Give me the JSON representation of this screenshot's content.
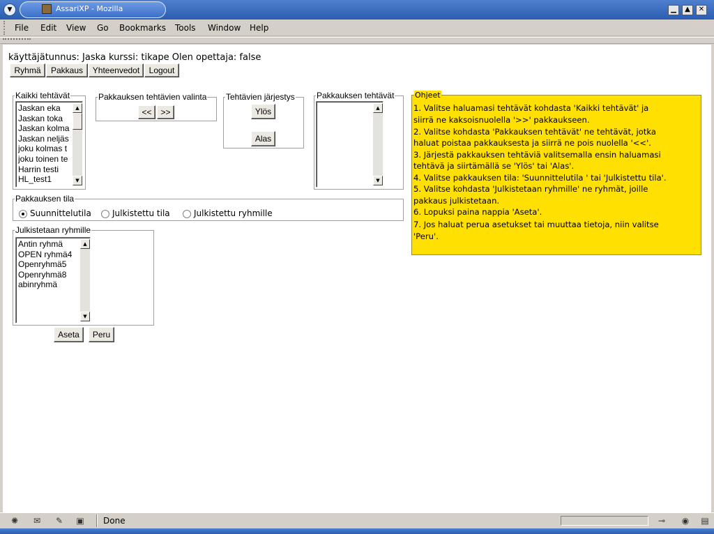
{
  "window": {
    "title": "AssariXP - Mozilla"
  },
  "menu": [
    "File",
    "Edit",
    "View",
    "Go",
    "Bookmarks",
    "Tools",
    "Window",
    "Help"
  ],
  "info_line": "käyttäjätunnus: Jaska kurssi: tikape Olen opettaja: false",
  "nav_buttons": [
    "Ryhmä",
    "Pakkaus",
    "Yhteenvedot",
    "Logout"
  ],
  "all_tasks": {
    "legend": "Kaikki tehtävät",
    "items": [
      "Jaskan eka",
      "Jaskan toka",
      "Jaskan kolma",
      "Jaskan neljäs",
      "joku kolmas t",
      "joku toinen te",
      "Harrin testi",
      "HL_test1"
    ]
  },
  "package_selection": {
    "legend": "Pakkauksen tehtävien valinta",
    "left": "<<",
    "right": ">>"
  },
  "task_order": {
    "legend": "Tehtävien järjestys",
    "up": "Ylös",
    "down": "Alas"
  },
  "package_tasks": {
    "legend": "Pakkauksen tehtävät"
  },
  "package_state": {
    "legend": "Pakkauksen tila",
    "options": [
      "Suunnittelutila",
      "Julkistettu tila",
      "Julkistettu ryhmille"
    ],
    "selected": 0
  },
  "publish_groups": {
    "legend": "Julkistetaan ryhmille",
    "items": [
      "Antin ryhmä",
      "OPEN ryhmä4",
      "Openryhmä5",
      "Openryhmä8",
      "abinryhmä"
    ]
  },
  "actions": {
    "set": "Aseta",
    "cancel": "Peru"
  },
  "help": {
    "legend": "Ohjeet",
    "lines": [
      "1. Valitse haluamasi tehtävät kohdasta 'Kaikki tehtävät' ja",
      "siirrä ne kaksoisnuolella '>>' pakkaukseen.",
      "2. Valitse kohdasta 'Pakkauksen tehtävät' ne tehtävät, jotka",
      "haluat poistaa pakkauksesta ja siirrä ne pois nuolella '<<'.",
      "3. Järjestä pakkauksen tehtäviä valitsemalla ensin haluamasi",
      "tehtävä ja siirtämällä se 'Ylös' tai 'Alas'.",
      "4. Valitse pakkauksen tila: 'Suunnittelutila ' tai 'Julkistettu tila'.",
      "5. Valitse kohdasta 'Julkistetaan ryhmille' ne ryhmät, joille",
      "pakkaus julkistetaan.",
      "6. Lopuksi paina nappia 'Aseta'.",
      "7. Jos haluat perua asetukset tai muuttaa tietoja, niin valitse",
      "'Peru'."
    ],
    "color": "#ffe000"
  },
  "status": {
    "text": "Done"
  }
}
